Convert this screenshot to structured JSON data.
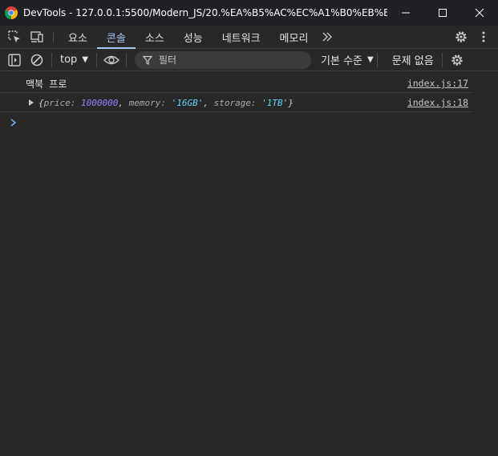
{
  "window": {
    "title": "DevTools - 127.0.0.1:5500/Modern_JS/20.%EA%B5%AC%EC%A1%B0%EB%B6%84...",
    "icon": "chrome-icon",
    "controls": [
      "minimize-icon",
      "maximize-icon",
      "close-icon"
    ]
  },
  "tabs": [
    {
      "label": "요소",
      "active": false
    },
    {
      "label": "콘솔",
      "active": true
    },
    {
      "label": "소스",
      "active": false
    },
    {
      "label": "성능",
      "active": false
    },
    {
      "label": "네트워크",
      "active": false
    },
    {
      "label": "메모리",
      "active": false
    }
  ],
  "toolbar": {
    "context": "top",
    "filter_placeholder": "필터",
    "levels": "기본 수준",
    "issues": "문제 없음"
  },
  "console": {
    "messages": [
      {
        "text": "맥북 프로",
        "source": "index.js:17"
      },
      {
        "source": "index.js:18",
        "object": {
          "open": "{",
          "k1": "price: ",
          "v1": "1000000",
          "sep1": ", ",
          "k2": "memory: ",
          "v2": "'16GB'",
          "sep2": ", ",
          "k3": "storage: ",
          "v3": "'1TB'",
          "close": "}"
        }
      }
    ]
  },
  "colors": {
    "accent": "#a8c7fa",
    "number": "#9980ff",
    "string": "#5cd5fb",
    "background": "#282828"
  }
}
